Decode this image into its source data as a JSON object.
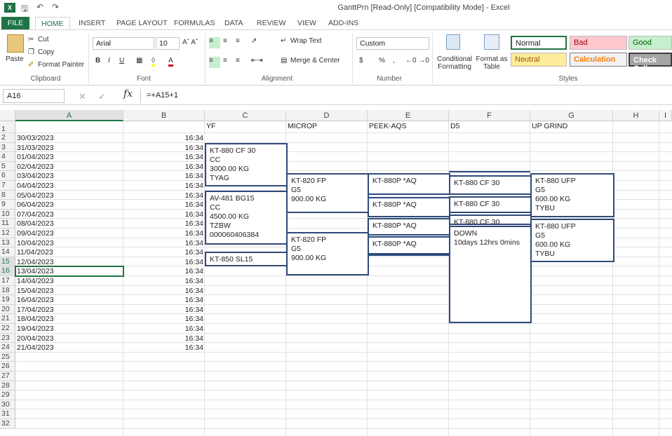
{
  "window": {
    "title": "GanttPrn  [Read-Only]  [Compatibility Mode] - Excel"
  },
  "tabs": [
    "FILE",
    "HOME",
    "INSERT",
    "PAGE LAYOUT",
    "FORMULAS",
    "DATA",
    "REVIEW",
    "VIEW",
    "ADD-INS"
  ],
  "ribbon": {
    "clipboard": {
      "paste": "Paste",
      "cut": "Cut",
      "copy": "Copy",
      "format_painter": "Format Painter",
      "label": "Clipboard"
    },
    "font": {
      "name": "Arial",
      "size": "10",
      "label": "Font"
    },
    "alignment": {
      "wrap": "Wrap Text",
      "merge": "Merge & Center",
      "label": "Alignment"
    },
    "number": {
      "format": "Custom",
      "currency": "$",
      "percent": "%",
      "comma": ",",
      "label": "Number"
    },
    "styles_group": {
      "conditional": "Conditional Formatting",
      "format_table": "Format as Table",
      "label": "Styles"
    },
    "styles": [
      {
        "name": "Normal",
        "bg": "#ffffff",
        "fg": "#222222"
      },
      {
        "name": "Bad",
        "bg": "#ffc7ce",
        "fg": "#9c0006"
      },
      {
        "name": "Good",
        "bg": "#c6efce",
        "fg": "#006100"
      },
      {
        "name": "Neutral",
        "bg": "#ffeb9c",
        "fg": "#9c5700"
      },
      {
        "name": "Calculation",
        "bg": "#f2f2f2",
        "fg": "#fa7d00"
      },
      {
        "name": "Check Cell",
        "bg": "#a5a5a5",
        "fg": "#ffffff"
      }
    ]
  },
  "formula_bar": {
    "name_box": "A16",
    "fx": "fx",
    "formula": "=+A15+1"
  },
  "columns": [
    "A",
    "B",
    "C",
    "D",
    "E",
    "F",
    "G",
    "H",
    "I"
  ],
  "headers_row1": {
    "C": "YF",
    "D": "MICROP",
    "E": "PEEK-AQS",
    "F": "D5",
    "G": "UP GRIND"
  },
  "rows": [
    {
      "n": "1",
      "a": "",
      "b": ""
    },
    {
      "n": "2",
      "a": "30/03/2023",
      "b": "16:34"
    },
    {
      "n": "3",
      "a": "31/03/2023",
      "b": "16:34"
    },
    {
      "n": "4",
      "a": "01/04/2023",
      "b": "16:34"
    },
    {
      "n": "5",
      "a": "02/04/2023",
      "b": "16:34"
    },
    {
      "n": "6",
      "a": "03/04/2023",
      "b": "16:34"
    },
    {
      "n": "7",
      "a": "04/04/2023",
      "b": "16:34"
    },
    {
      "n": "8",
      "a": "05/04/2023",
      "b": "16:34"
    },
    {
      "n": "9",
      "a": "06/04/2023",
      "b": "16:34"
    },
    {
      "n": "10",
      "a": "07/04/2023",
      "b": "16:34"
    },
    {
      "n": "11",
      "a": "08/04/2023",
      "b": "16:34"
    },
    {
      "n": "12",
      "a": "09/04/2023",
      "b": "16:34"
    },
    {
      "n": "13",
      "a": "10/04/2023",
      "b": "16:34"
    },
    {
      "n": "14",
      "a": "11/04/2023",
      "b": "16:34"
    },
    {
      "n": "15",
      "a": "12/04/2023",
      "b": "16:34"
    },
    {
      "n": "16",
      "a": "13/04/2023",
      "b": "16:34"
    },
    {
      "n": "17",
      "a": "14/04/2023",
      "b": "16:34"
    },
    {
      "n": "18",
      "a": "15/04/2023",
      "b": "16:34"
    },
    {
      "n": "19",
      "a": "16/04/2023",
      "b": "16:34"
    },
    {
      "n": "20",
      "a": "17/04/2023",
      "b": "16:34"
    },
    {
      "n": "21",
      "a": "18/04/2023",
      "b": "16:34"
    },
    {
      "n": "22",
      "a": "19/04/2023",
      "b": "16:34"
    },
    {
      "n": "23",
      "a": "20/04/2023",
      "b": "16:34"
    },
    {
      "n": "24",
      "a": "21/04/2023",
      "b": "16:34"
    },
    {
      "n": "25",
      "a": "",
      "b": ""
    },
    {
      "n": "26",
      "a": "",
      "b": ""
    },
    {
      "n": "27",
      "a": "",
      "b": ""
    },
    {
      "n": "28",
      "a": "",
      "b": ""
    },
    {
      "n": "29",
      "a": "",
      "b": ""
    },
    {
      "n": "30",
      "a": "",
      "b": ""
    },
    {
      "n": "31",
      "a": "",
      "b": ""
    },
    {
      "n": "32",
      "a": "",
      "b": ""
    }
  ],
  "gantt": {
    "yf_1": "KT-880 CF 30\nCC\n3000.00 KG\nTYAG",
    "yf_2": "AV-481 BG15\nCC\n4500.00 KG\nTZBW\n000060406384",
    "yf_3": "KT-850 SL15",
    "microp_1": "KT-820 FP\nG5\n900.00 KG",
    "microp_2": "KT-820 FP\nG5\n900.00 KG",
    "peek_1": "KT-880P *AQ",
    "peek_2": "KT-880P *AQ",
    "peek_3": "KT-880P *AQ",
    "peek_4": "KT-880P *AQ",
    "d5_1": "KT-880 CF 30",
    "d5_2": "KT-880 CF 30",
    "d5_3": "KT-880 CF 30",
    "d5_4": "DOWN\n10days 12hrs 0mins",
    "grind_1": "KT-880 UFP\nG5\n600.00 KG\nTYBU",
    "grind_2": "KT-880 UFP\nG5\n600.00 KG\nTYBU"
  }
}
